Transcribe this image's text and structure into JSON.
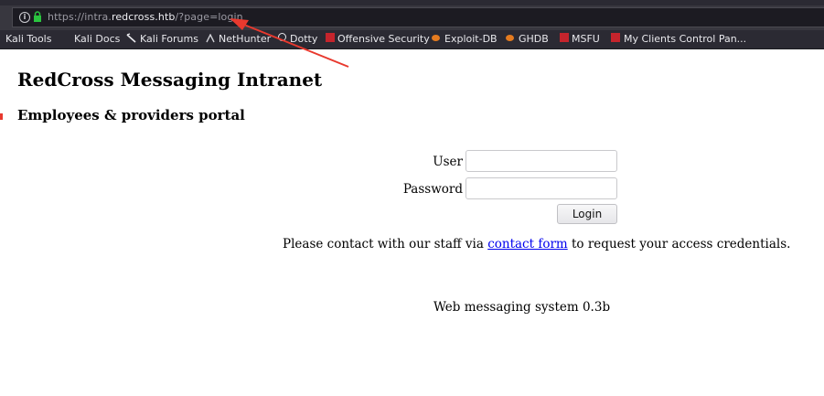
{
  "browser": {
    "url_scheme": "https://intra.",
    "url_host": "redcross.htb",
    "url_path": "/?page=login",
    "bookmarks": [
      {
        "label": "Kali Tools",
        "icon": "kali-icon"
      },
      {
        "label": "Kali Docs",
        "icon": "kali-docs-icon"
      },
      {
        "label": "Kali Forums",
        "icon": "kali-forums-icon"
      },
      {
        "label": "NetHunter",
        "icon": "nethunter-icon"
      },
      {
        "label": "Dotty",
        "icon": "globe-icon"
      },
      {
        "label": "Offensive Security",
        "icon": "offsec-icon"
      },
      {
        "label": "Exploit-DB",
        "icon": "exploitdb-icon"
      },
      {
        "label": "GHDB",
        "icon": "ghdb-icon"
      },
      {
        "label": "MSFU",
        "icon": "offsec-icon"
      },
      {
        "label": "My Clients Control Pan...",
        "icon": "offsec-icon"
      }
    ]
  },
  "page": {
    "title": "RedCross Messaging Intranet",
    "subtitle": "Employees & providers portal",
    "form": {
      "user_label": "User",
      "user_value": "",
      "password_label": "Password",
      "password_value": "",
      "login_label": "Login"
    },
    "note": {
      "before": "Please contact with our staff via ",
      "link": "contact form",
      "after": " to request your access credentials."
    },
    "footer": "Web messaging system 0.3b"
  },
  "colors": {
    "annotation": "#e8392e",
    "link": "#0000ee",
    "chrome_dark": "#2b2a33"
  }
}
